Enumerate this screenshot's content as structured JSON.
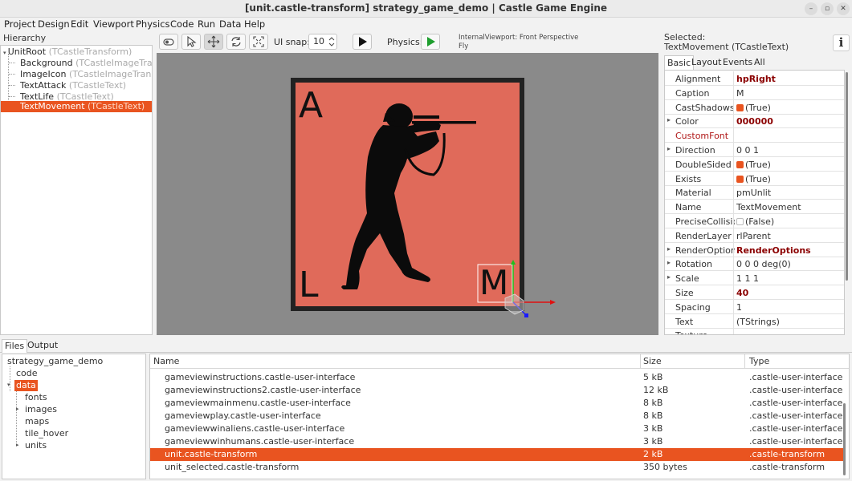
{
  "window": {
    "title": "[unit.castle-transform] strategy_game_demo | Castle Game Engine",
    "min_glyph": "–",
    "max_glyph": "▫",
    "close_glyph": "✕"
  },
  "menu": [
    "Project",
    "Design",
    "Edit",
    "Viewport",
    "Physics",
    "Code",
    "Run",
    "Data",
    "Help"
  ],
  "hierarchy": {
    "label": "Hierarchy",
    "items": [
      {
        "name": "UnitRoot",
        "cls": "(TCastleTransform)"
      },
      {
        "name": "Background",
        "cls": "(TCastleImageTransform)"
      },
      {
        "name": "ImageIcon",
        "cls": "(TCastleImageTransform)"
      },
      {
        "name": "TextAttack",
        "cls": "(TCastleText)"
      },
      {
        "name": "TextLife",
        "cls": "(TCastleText)"
      },
      {
        "name": "TextMovement",
        "cls": "(TCastleText)"
      }
    ]
  },
  "toolbar": {
    "ui_snap_label": "UI snap:",
    "ui_snap_value": "10",
    "physics_label": "Physics:",
    "viewport_info_line1": "InternalViewport: Front Perspective",
    "viewport_info_line2": "Fly"
  },
  "viewport": {
    "letter_top_left": "A",
    "letter_bottom_left": "L",
    "letter_bottom_right": "M",
    "card_color": "#e06a5a",
    "background_color": "#8a8a8a"
  },
  "inspector": {
    "selected_label": "Selected:",
    "selected_name": "TextMovement (TCastleText)",
    "info_glyph": "i",
    "tabs": [
      "Basic",
      "Layout",
      "Events",
      "All"
    ],
    "properties": [
      {
        "name": "Alignment",
        "value": "hpRight",
        "bold": true
      },
      {
        "name": "Caption",
        "value": "M"
      },
      {
        "name": "CastShadows",
        "value": "(True)",
        "check": "on"
      },
      {
        "name": "Color",
        "value": "000000",
        "bold": true,
        "expand": true
      },
      {
        "name": "CustomFont",
        "value": "",
        "custom": true
      },
      {
        "name": "Direction",
        "value": "0 0 1",
        "expand": true
      },
      {
        "name": "DoubleSided",
        "value": "(True)",
        "check": "on"
      },
      {
        "name": "Exists",
        "value": "(True)",
        "check": "on"
      },
      {
        "name": "Material",
        "value": "pmUnlit"
      },
      {
        "name": "Name",
        "value": "TextMovement"
      },
      {
        "name": "PreciseCollisions",
        "value": "(False)",
        "check": "off"
      },
      {
        "name": "RenderLayer",
        "value": "rlParent"
      },
      {
        "name": "RenderOptions",
        "value": "RenderOptions",
        "bold": true,
        "expand": true
      },
      {
        "name": "Rotation",
        "value": "0 0 0 deg(0)",
        "expand": true
      },
      {
        "name": "Scale",
        "value": "1 1 1",
        "expand": true
      },
      {
        "name": "Size",
        "value": "40",
        "bold": true
      },
      {
        "name": "Spacing",
        "value": "1"
      },
      {
        "name": "Text",
        "value": "(TStrings)"
      },
      {
        "name": "Texture",
        "value": ""
      }
    ]
  },
  "bottom_tabs": [
    "Files",
    "Output"
  ],
  "files_tree": [
    {
      "name": "strategy_game_demo",
      "level": 0
    },
    {
      "name": "code",
      "level": 1
    },
    {
      "name": "data",
      "level": 1,
      "expanded": true,
      "selected": true
    },
    {
      "name": "fonts",
      "level": 2
    },
    {
      "name": "images",
      "level": 2,
      "expandable": true
    },
    {
      "name": "maps",
      "level": 2
    },
    {
      "name": "tile_hover",
      "level": 2
    },
    {
      "name": "units",
      "level": 2,
      "expandable": true
    }
  ],
  "files_list": {
    "columns": [
      "Name",
      "Size",
      "Type"
    ],
    "rows": [
      {
        "name": "gameviewinstructions.castle-user-interface",
        "size": "5 kB",
        "type": ".castle-user-interface"
      },
      {
        "name": "gameviewinstructions2.castle-user-interface",
        "size": "12 kB",
        "type": ".castle-user-interface"
      },
      {
        "name": "gameviewmainmenu.castle-user-interface",
        "size": "8 kB",
        "type": ".castle-user-interface"
      },
      {
        "name": "gameviewplay.castle-user-interface",
        "size": "8 kB",
        "type": ".castle-user-interface"
      },
      {
        "name": "gameviewwinaliens.castle-user-interface",
        "size": "3 kB",
        "type": ".castle-user-interface"
      },
      {
        "name": "gameviewwinhumans.castle-user-interface",
        "size": "3 kB",
        "type": ".castle-user-interface"
      },
      {
        "name": "unit.castle-transform",
        "size": "2 kB",
        "type": ".castle-transform",
        "selected": true
      },
      {
        "name": "unit_selected.castle-transform",
        "size": "350 bytes",
        "type": ".castle-transform"
      }
    ]
  },
  "colors": {
    "accent": "#e95420",
    "play_green": "#1e9e2e"
  }
}
